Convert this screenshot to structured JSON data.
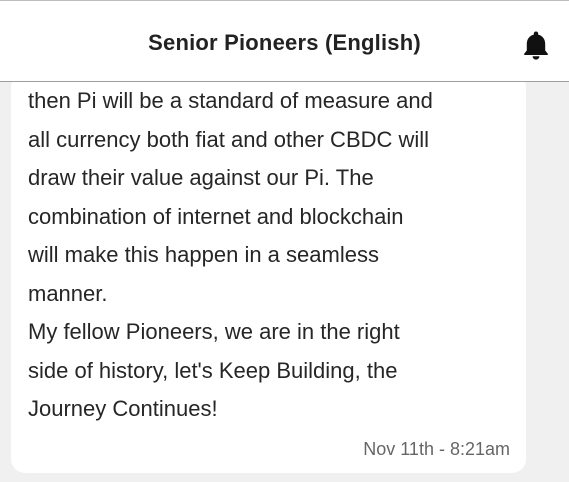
{
  "header": {
    "title": "Senior Pioneers (English)",
    "notification_icon": "bell-icon"
  },
  "message": {
    "lines": [
      "then Pi will be a standard of measure and",
      "all currency both fiat and other CBDC will",
      "draw their value against our Pi. The",
      "combination of internet and blockchain",
      "will make this happen in a seamless",
      "manner.",
      "My fellow Pioneers, we are in the right",
      "side of history, let's Keep Building, the",
      "Journey Continues!"
    ],
    "timestamp": "Nov 11th - 8:21am"
  },
  "colors": {
    "background": "#f0f0f0",
    "bubble": "#ffffff",
    "text": "#262626",
    "timestamp": "#666666"
  }
}
